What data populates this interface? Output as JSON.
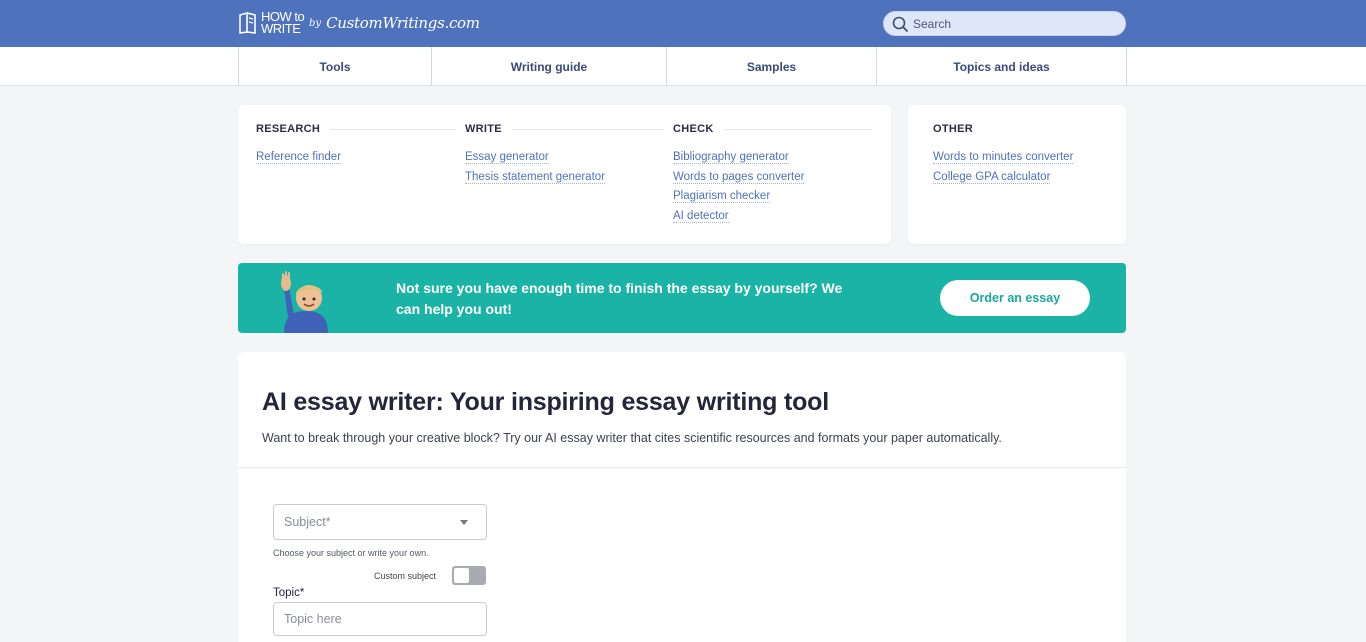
{
  "header": {
    "logo": {
      "line1": "HOW to",
      "line2": "WRITE",
      "by": "by",
      "brand": "CustomWritings.com"
    },
    "search": {
      "placeholder": "Search"
    }
  },
  "nav": {
    "tabs": [
      {
        "label": "Tools"
      },
      {
        "label": "Writing guide"
      },
      {
        "label": "Samples"
      },
      {
        "label": "Topics and ideas"
      }
    ]
  },
  "tools_menu": {
    "research": {
      "heading": "RESEARCH",
      "items": [
        "Reference finder"
      ]
    },
    "write": {
      "heading": "WRITE",
      "items": [
        "Essay generator",
        "Thesis statement generator"
      ]
    },
    "check": {
      "heading": "CHECK",
      "items": [
        "Bibliography generator",
        "Words to pages converter",
        "Plagiarism checker",
        "AI detector"
      ]
    },
    "other": {
      "heading": "OTHER",
      "items": [
        "Words to minutes converter",
        "College GPA calculator"
      ]
    }
  },
  "banner": {
    "text": "Not sure you have enough time to finish the essay by yourself? We can help you out!",
    "button": "Order an essay",
    "colors": {
      "background": "#1ab3a6",
      "button_text": "#19a99c"
    }
  },
  "main": {
    "title": "AI essay writer: Your inspiring essay writing tool",
    "description": "Want to break through your creative block? Try our AI essay writer that cites scientific resources and formats your paper automatically.",
    "form": {
      "subject_placeholder": "Subject*",
      "subject_hint": "Choose your subject or write your own.",
      "custom_subject_label": "Custom subject",
      "custom_subject_on": false,
      "topic_label": "Topic*",
      "topic_placeholder": "Topic here"
    }
  },
  "colors": {
    "header": "#4f72bd",
    "link": "#4f72bd",
    "page_bg": "#f4f5f7"
  },
  "icons": {
    "search": "search-icon",
    "logo": "book-icon",
    "avatar": "waving-person-icon"
  }
}
